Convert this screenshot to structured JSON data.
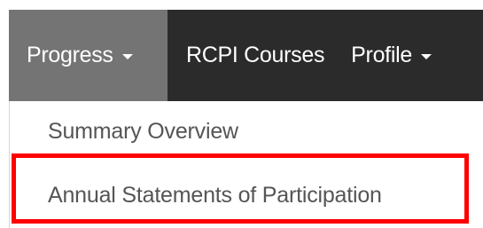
{
  "navbar": {
    "items": [
      {
        "label": "Progress",
        "has_dropdown": true,
        "active": true
      },
      {
        "label": "RCPI Courses",
        "has_dropdown": false,
        "active": false
      },
      {
        "label": "Profile",
        "has_dropdown": true,
        "active": false
      }
    ]
  },
  "dropdown": {
    "items": [
      {
        "label": "Summary Overview"
      },
      {
        "label": "Annual Statements of Participation",
        "highlighted": true
      }
    ]
  },
  "colors": {
    "navbar_bg": "#2b2b2b",
    "active_item_bg": "#747474",
    "nav_text": "#ffffff",
    "dropdown_text": "#555555",
    "highlight_border": "#ff0000"
  },
  "icons": [
    "caret-down-icon"
  ]
}
